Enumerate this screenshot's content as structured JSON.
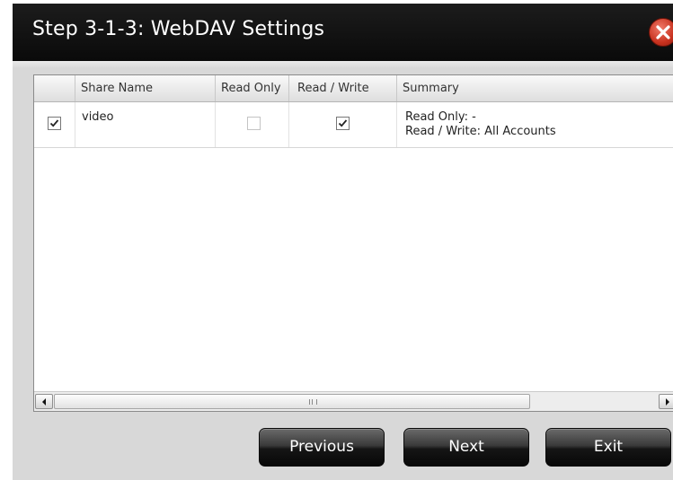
{
  "dialog": {
    "title": "Step 3-1-3: WebDAV Settings",
    "close_icon": "close-x-icon",
    "accent_close": "#c8321f"
  },
  "table": {
    "headers": [
      "",
      "Share Name",
      "Read Only",
      "Read / Write",
      "Summary"
    ],
    "rows": [
      {
        "selected": true,
        "share_name": "video",
        "read_only": false,
        "read_only_enabled": false,
        "read_write": true,
        "summary_line1": "Read Only: -",
        "summary_line2": "Read / Write: All Accounts"
      }
    ]
  },
  "scrollbar": {
    "left_icon": "arrow-left-icon",
    "right_icon": "arrow-right-icon"
  },
  "buttons": {
    "previous": "Previous",
    "next": "Next",
    "exit": "Exit"
  }
}
